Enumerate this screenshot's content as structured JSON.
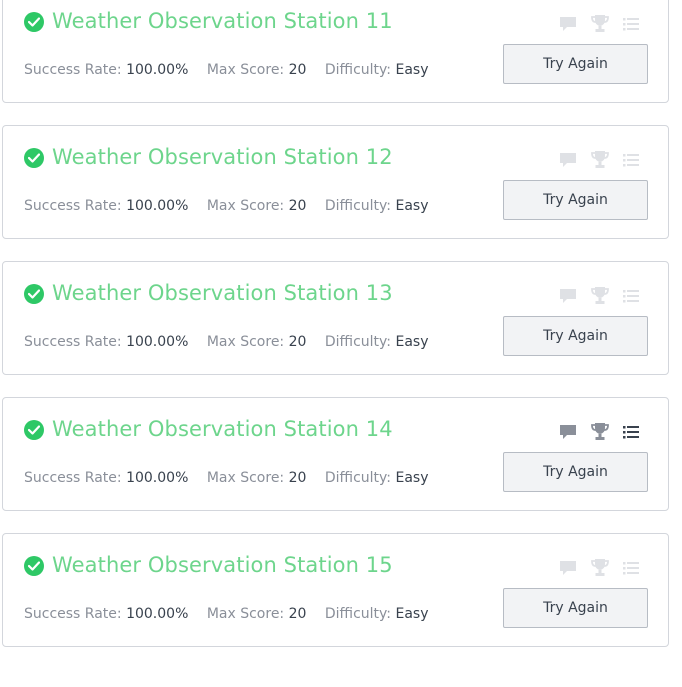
{
  "challenges": [
    {
      "title": "Weather Observation Station 11",
      "success_rate_label": "Success Rate:",
      "success_rate": "100.00%",
      "max_score_label": "Max Score:",
      "max_score": "20",
      "difficulty_label": "Difficulty:",
      "difficulty": "Easy",
      "button_label": "Try Again",
      "icons": [
        "discussion-icon",
        "leaderboard-trophy-icon",
        "editorial-list-icon"
      ]
    },
    {
      "title": "Weather Observation Station 12",
      "success_rate_label": "Success Rate:",
      "success_rate": "100.00%",
      "max_score_label": "Max Score:",
      "max_score": "20",
      "difficulty_label": "Difficulty:",
      "difficulty": "Easy",
      "button_label": "Try Again",
      "icons": [
        "discussion-icon",
        "leaderboard-trophy-icon",
        "editorial-list-icon"
      ]
    },
    {
      "title": "Weather Observation Station 13",
      "success_rate_label": "Success Rate:",
      "success_rate": "100.00%",
      "max_score_label": "Max Score:",
      "max_score": "20",
      "difficulty_label": "Difficulty:",
      "difficulty": "Easy",
      "button_label": "Try Again",
      "icons": [
        "discussion-icon",
        "leaderboard-trophy-icon",
        "editorial-list-icon"
      ]
    },
    {
      "title": "Weather Observation Station 14",
      "success_rate_label": "Success Rate:",
      "success_rate": "100.00%",
      "max_score_label": "Max Score:",
      "max_score": "20",
      "difficulty_label": "Difficulty:",
      "difficulty": "Easy",
      "button_label": "Try Again",
      "icons": [
        "discussion-icon",
        "leaderboard-trophy-icon",
        "editorial-list-icon"
      ],
      "hovered": true
    },
    {
      "title": "Weather Observation Station 15",
      "success_rate_label": "Success Rate:",
      "success_rate": "100.00%",
      "max_score_label": "Max Score:",
      "max_score": "20",
      "difficulty_label": "Difficulty:",
      "difficulty": "Easy",
      "button_label": "Try Again",
      "icons": [
        "discussion-icon",
        "leaderboard-trophy-icon",
        "editorial-list-icon"
      ]
    }
  ],
  "colors": {
    "solved_green": "#2ec866",
    "title_green": "#6dd58c",
    "icon_muted": "#dfe1e5",
    "icon_active": "#8a8f99",
    "label_gray": "#8a8f99",
    "value_dark": "#39424e"
  }
}
